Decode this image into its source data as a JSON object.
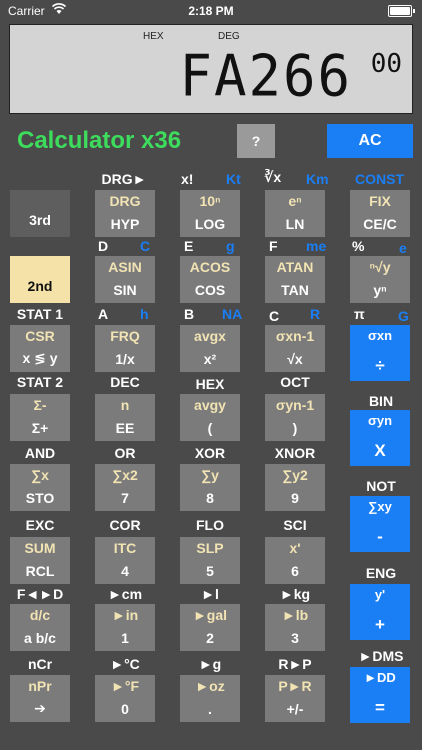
{
  "status": {
    "carrier": "Carrier",
    "time": "2:18 PM"
  },
  "display": {
    "ind_hex": "HEX",
    "ind_deg": "DEG",
    "value": "FA266",
    "exponent": "00"
  },
  "app": {
    "title": "Calculator x36",
    "help": "?",
    "ac": "AC"
  },
  "row1_labels": {
    "drg": "DRG►",
    "fact": "x!",
    "kt": "Kt",
    "cbrt": "∛x",
    "km": "Km",
    "const": "CONST"
  },
  "keys": {
    "k3rd": {
      "top": "",
      "bot": "3rd"
    },
    "hyp": {
      "top": "DRG",
      "bot": "HYP"
    },
    "log": {
      "top": "10ⁿ",
      "bot": "LOG"
    },
    "ln": {
      "top": "eⁿ",
      "bot": "LN"
    },
    "ce": {
      "top": "FIX",
      "bot": "CE/C"
    },
    "k2nd": {
      "top": "",
      "bot": "2nd"
    },
    "sin": {
      "top": "ASIN",
      "bot": "SIN"
    },
    "cos": {
      "top": "ACOS",
      "bot": "COS"
    },
    "tan": {
      "top": "ATAN",
      "bot": "TAN"
    },
    "pow": {
      "top": "ⁿ√y",
      "bot": "yⁿ"
    },
    "xy": {
      "top": "CSR",
      "bot": "x ≶ y"
    },
    "inv": {
      "top": "FRQ",
      "bot": "1/x"
    },
    "sq": {
      "top": "avgx",
      "bot": "x²"
    },
    "sqrt": {
      "top": "σxn-1",
      "bot": "√x"
    },
    "div": {
      "top": "σxn",
      "bot": "÷"
    },
    "sum": {
      "top": "Σ-",
      "bot": "Σ+"
    },
    "ee": {
      "top": "n",
      "bot": "EE"
    },
    "lpar": {
      "top": "avgy",
      "bot": "("
    },
    "rpar": {
      "top": "σyn-1",
      "bot": ")"
    },
    "mul": {
      "top": "σyn",
      "bot": "X"
    },
    "sto": {
      "top": "∑x",
      "bot": "STO"
    },
    "n7": {
      "top": "∑x2",
      "bot": "7"
    },
    "n8": {
      "top": "∑y",
      "bot": "8"
    },
    "n9": {
      "top": "∑y2",
      "bot": "9"
    },
    "sub": {
      "top": "∑xy",
      "bot": "-"
    },
    "rcl": {
      "top": "SUM",
      "bot": "RCL"
    },
    "n4": {
      "top": "ITC",
      "bot": "4"
    },
    "n5": {
      "top": "SLP",
      "bot": "5"
    },
    "n6": {
      "top": "x'",
      "bot": "6"
    },
    "add": {
      "top": "y'",
      "bot": "+"
    },
    "frac": {
      "top": "d/c",
      "bot": "a b/c"
    },
    "n1": {
      "top": "►in",
      "bot": "1"
    },
    "n2": {
      "top": "►gal",
      "bot": "2"
    },
    "n3": {
      "top": "►lb",
      "bot": "3"
    },
    "arrow": {
      "top": "nPr",
      "bot": "➔"
    },
    "n0": {
      "top": "►°F",
      "bot": "0"
    },
    "dot": {
      "top": "►oz",
      "bot": "."
    },
    "neg": {
      "top": "P►R",
      "bot": "+/-"
    },
    "eq": {
      "top": "►DD",
      "bot": "="
    }
  },
  "labels": {
    "d": "D",
    "c_blue": "C",
    "e": "E",
    "g_blue": "g",
    "f": "F",
    "me": "me",
    "pct": "%",
    "e_blue": "e",
    "stat1": "STAT 1",
    "a": "A",
    "h_blue": "h",
    "b": "B",
    "na": "NA",
    "c": "C",
    "r_blue": "R",
    "pi": "π",
    "G_blue": "G",
    "stat2": "STAT 2",
    "dec": "DEC",
    "hex": "HEX",
    "oct": "OCT",
    "bin": "BIN",
    "and": "AND",
    "or": "OR",
    "xor": "XOR",
    "xnor": "XNOR",
    "not": "NOT",
    "exc": "EXC",
    "cor": "COR",
    "flo": "FLO",
    "sci": "SCI",
    "eng": "ENG",
    "fd": "F◄►D",
    "cm": "►cm",
    "l": "►l",
    "kg": "►kg",
    "ncr": "nCr",
    "c_deg": "►°C",
    "g": "►g",
    "rp": "R►P",
    "dms": "►DMS"
  }
}
